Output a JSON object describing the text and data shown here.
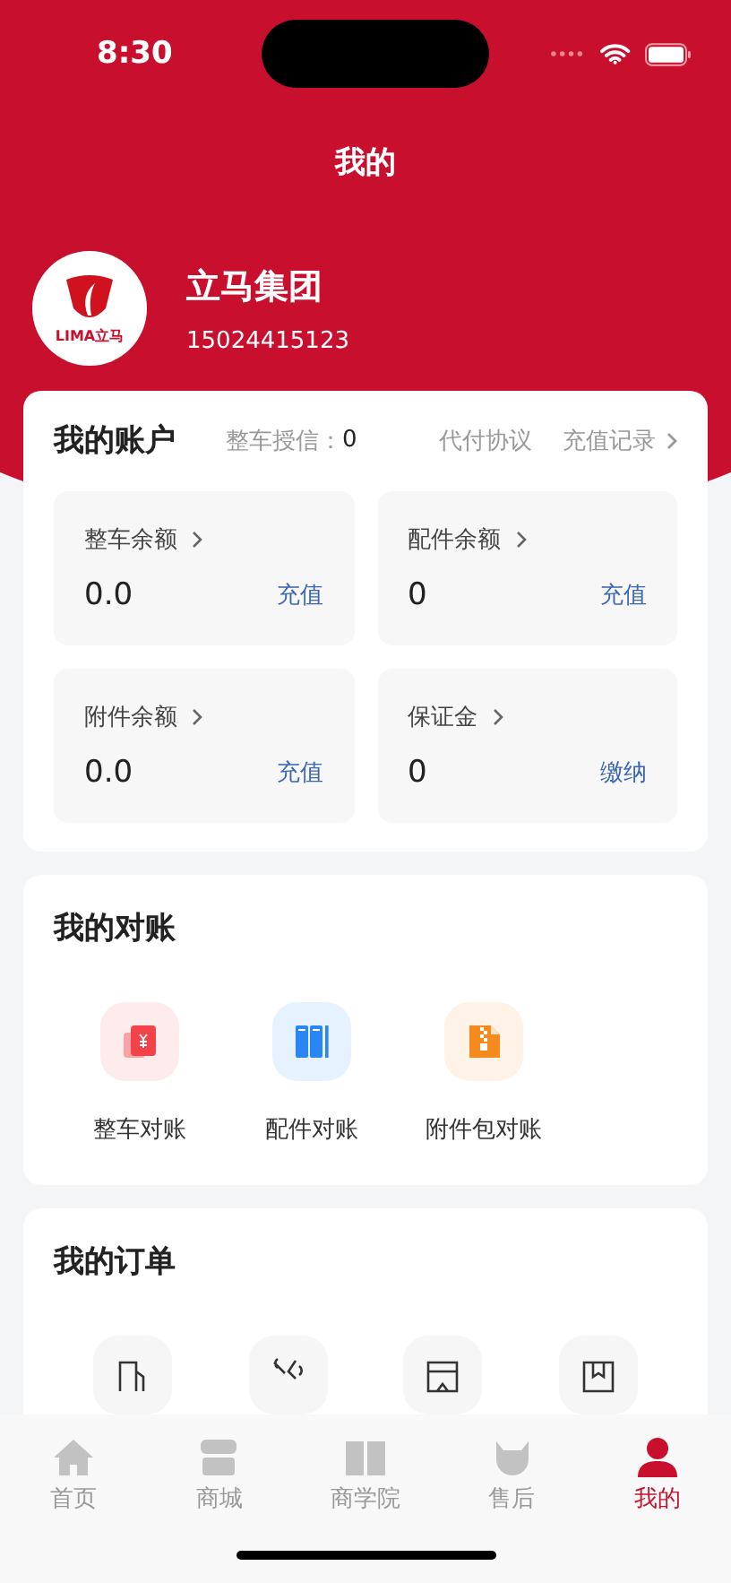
{
  "status_bar": {
    "time": "8:30"
  },
  "header": {
    "title": "我的"
  },
  "profile": {
    "name": "立马集团",
    "phone": "15024415123",
    "logo_text": "LIMA立马"
  },
  "account": {
    "title": "我的账户",
    "credit_label": "整车授信：",
    "credit_value": "0",
    "links": [
      "代付协议",
      "充值记录"
    ],
    "balances": [
      {
        "label": "整车余额",
        "value": "0.0",
        "action": "充值"
      },
      {
        "label": "配件余额",
        "value": "0",
        "action": "充值"
      },
      {
        "label": "附件余额",
        "value": "0.0",
        "action": "充值"
      },
      {
        "label": "保证金",
        "value": "0",
        "action": "缴纳"
      }
    ]
  },
  "reconciliation": {
    "title": "我的对账",
    "items": [
      {
        "label": "整车对账",
        "kind": "vehicle"
      },
      {
        "label": "配件对账",
        "kind": "parts"
      },
      {
        "label": "附件包对账",
        "kind": "package"
      }
    ]
  },
  "orders": {
    "title": "我的订单",
    "items": [
      {
        "kind": "vehicle"
      },
      {
        "kind": "parts"
      },
      {
        "kind": "package"
      },
      {
        "kind": "box"
      }
    ]
  },
  "tab_bar": [
    {
      "label": "首页",
      "kind": "home",
      "selected": false
    },
    {
      "label": "商城",
      "kind": "store",
      "selected": false
    },
    {
      "label": "商学院",
      "kind": "book",
      "selected": false
    },
    {
      "label": "售后",
      "kind": "service",
      "selected": false
    },
    {
      "label": "我的",
      "kind": "person",
      "selected": true
    }
  ]
}
